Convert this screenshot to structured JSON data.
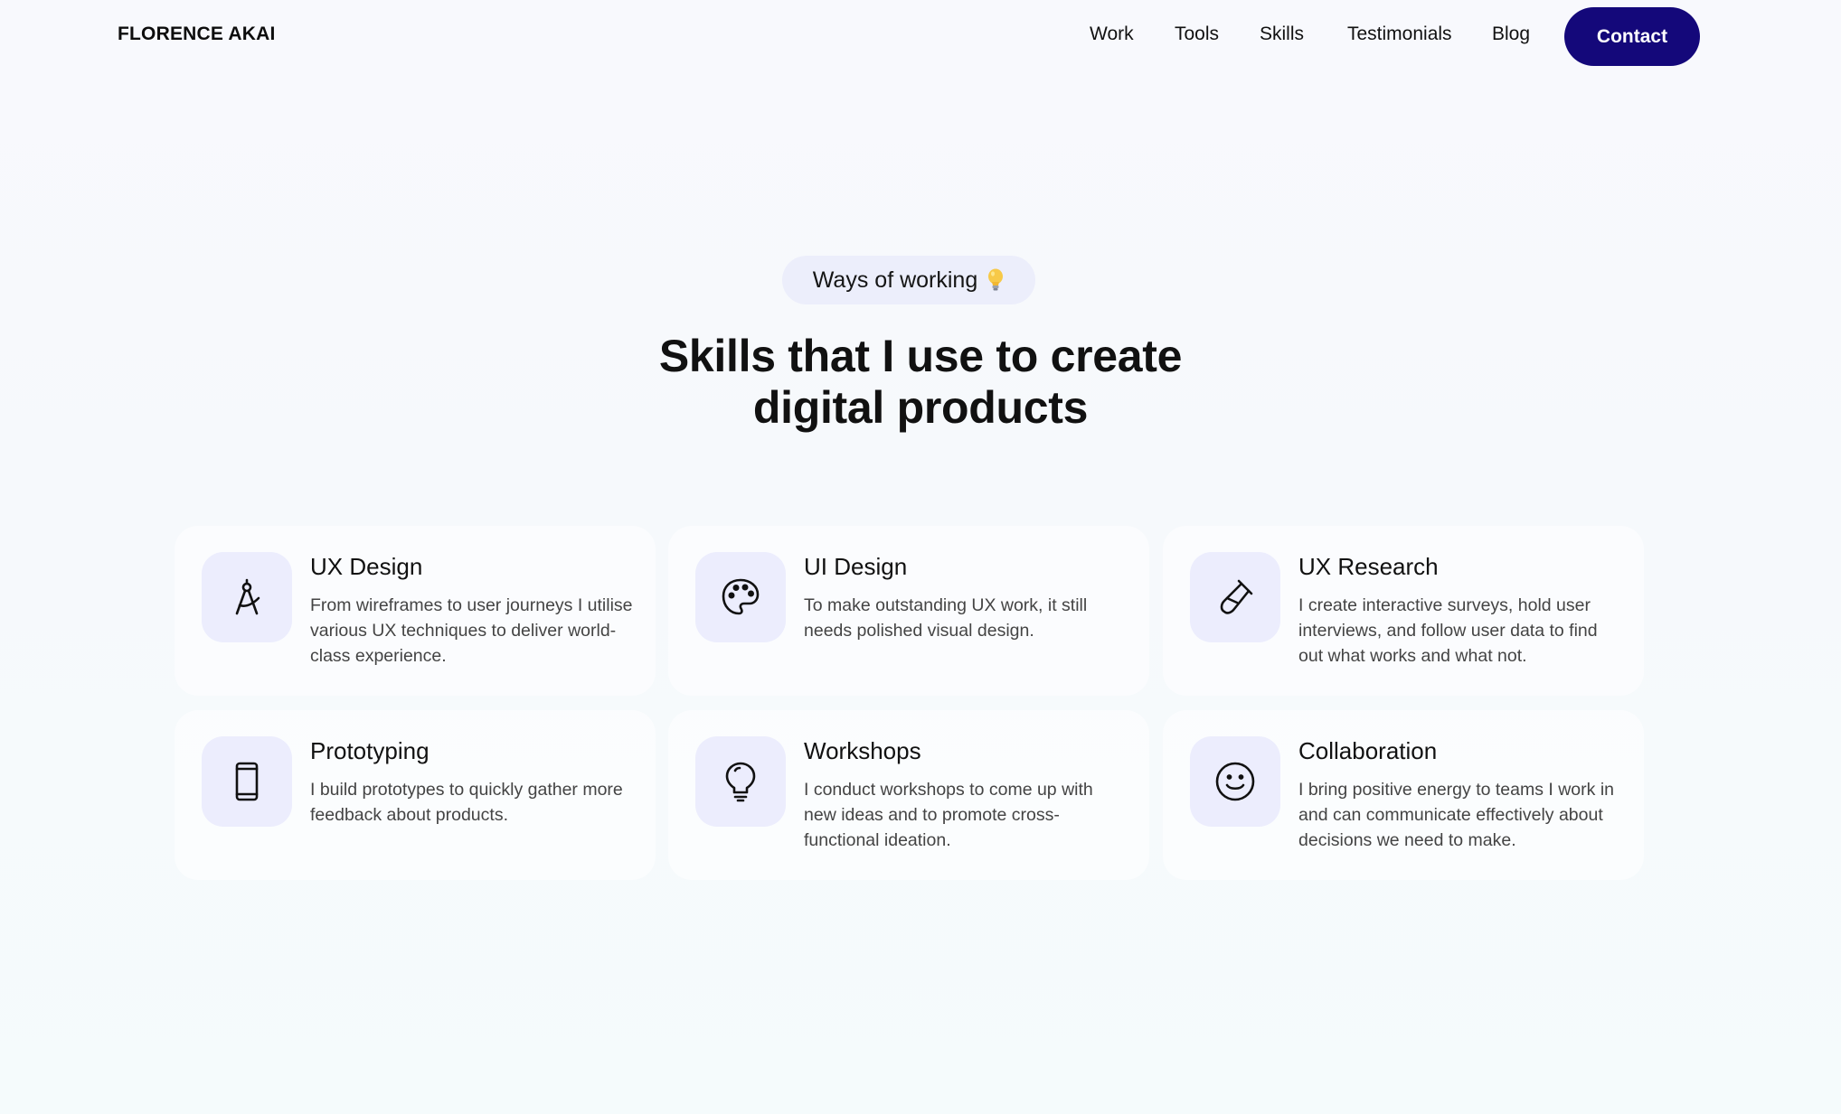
{
  "header": {
    "brand": "FLORENCE AKAI",
    "nav": [
      "Work",
      "Tools",
      "Skills",
      "Testimonials",
      "Blog"
    ],
    "contact_label": "Contact"
  },
  "section": {
    "eyebrow": "Ways of working",
    "eyebrow_emoji": "lightbulb-emoji-icon",
    "title_line1": "Skills that I use to create",
    "title_line2": "digital products"
  },
  "skills": [
    {
      "title": "UX Design",
      "description": "From wireframes to user journeys I utilise various UX techniques to deliver world-class experience.",
      "icon": "compass-drawing-icon"
    },
    {
      "title": "UI Design",
      "description": "To make outstanding UX work, it still needs polished visual design.",
      "icon": "palette-icon"
    },
    {
      "title": "UX Research",
      "description": "I create interactive surveys, hold user interviews, and follow user data to find out what works and what not.",
      "icon": "test-tube-icon"
    },
    {
      "title": "Prototyping",
      "description": "I build prototypes to quickly gather more feedback about products.",
      "icon": "smartphone-icon"
    },
    {
      "title": "Workshops",
      "description": "I conduct workshops to come up with new ideas and to promote cross-functional ideation.",
      "icon": "lightbulb-icon"
    },
    {
      "title": "Collaboration",
      "description": "I bring positive energy to teams I work in and can communicate effectively about decisions we need to make.",
      "icon": "smiley-face-icon"
    }
  ],
  "colors": {
    "accent": "#14087a",
    "icon_bg": "#ecedfd",
    "pill_bg": "#eceefb"
  }
}
